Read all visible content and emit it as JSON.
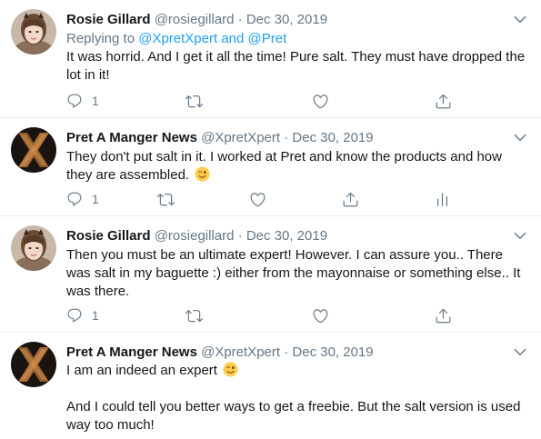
{
  "tweets": [
    {
      "display_name": "Rosie Gillard",
      "handle": "@rosiegillard",
      "separator": "·",
      "date": "Dec 30, 2019",
      "replying_prefix": "Replying to ",
      "replying_user1": "@XpretXpert",
      "replying_and": " and ",
      "replying_user2": "@Pret",
      "text": "It was horrid. And I get it all the time! Pure salt. They must have dropped the lot in it!",
      "reply_count": "1",
      "avatar_icon": "rosie-avatar"
    },
    {
      "display_name": "Pret A Manger News",
      "handle": "@XpretXpert",
      "separator": "·",
      "date": "Dec 30, 2019",
      "text": "They don't put salt in it. I worked at Pret and know the products and how they are assembled.",
      "emoji": "winking-face",
      "reply_count": "1",
      "avatar_icon": "x-avatar"
    },
    {
      "display_name": "Rosie Gillard",
      "handle": "@rosiegillard",
      "separator": "·",
      "date": "Dec 30, 2019",
      "text": "Then you must be an ultimate expert! However. I can assure you.. There was salt in my baguette :) either from the mayonnaise or something else.. It was there.",
      "reply_count": "1",
      "avatar_icon": "rosie-avatar"
    },
    {
      "display_name": "Pret A Manger News",
      "handle": "@XpretXpert",
      "separator": "·",
      "date": "Dec 30, 2019",
      "text_line1": "I am an indeed an expert",
      "emoji": "winking-face",
      "text_para2": "And I could tell you better ways to get a freebie. But the salt version is used way too much!",
      "avatar_icon": "x-avatar"
    }
  ],
  "colors": {
    "text": "#14171a",
    "secondary": "#657786",
    "link": "#1da1f2",
    "divider": "#e6ecf0"
  }
}
